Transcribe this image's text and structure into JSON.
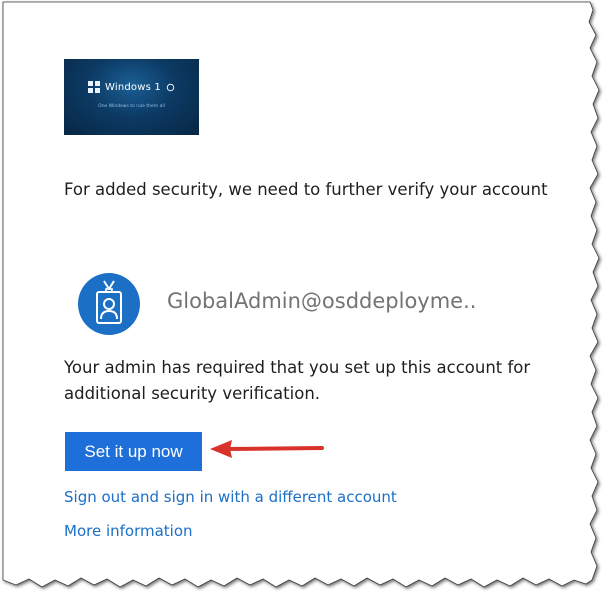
{
  "logo": {
    "title": "Windows 1",
    "tagline": "One Windows to rule them all"
  },
  "page": {
    "headline": "For added security, we need to further verify your account",
    "account": "GlobalAdmin@osddeployme..",
    "message": "Your admin has required that you set up this account for additional security verification."
  },
  "actions": {
    "setup_label": "Set it up now",
    "signout_label": "Sign out and sign in with a different account",
    "more_label": "More information"
  },
  "icons": {
    "avatar": "id-badge-icon",
    "windows": "windows-logo-icon",
    "annotation": "red-arrow-icon"
  },
  "colors": {
    "button": "#1e6fd9",
    "link": "#1a6fc9",
    "avatar": "#1b6fc5",
    "arrow": "#d9322b",
    "logo_bg": "#0c3a64"
  }
}
